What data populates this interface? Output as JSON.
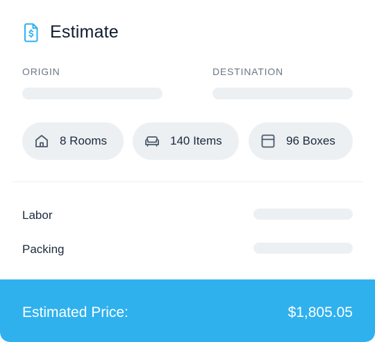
{
  "header": {
    "title": "Estimate",
    "icon": "invoice-dollar-icon"
  },
  "route": {
    "origin_label": "ORIGIN",
    "destination_label": "DESTINATION"
  },
  "chips": [
    {
      "label": "8 Rooms",
      "icon": "house-icon"
    },
    {
      "label": "140 Items",
      "icon": "sofa-icon"
    },
    {
      "label": "96 Boxes",
      "icon": "box-icon"
    }
  ],
  "costs": {
    "labor_label": "Labor",
    "packing_label": "Packing"
  },
  "footer": {
    "label": "Estimated Price:",
    "value": "$1,805.05"
  },
  "colors": {
    "accent": "#2fb1ee",
    "skeleton": "#edf0f3",
    "text": "#0f1b2e",
    "muted": "#6b7785"
  }
}
